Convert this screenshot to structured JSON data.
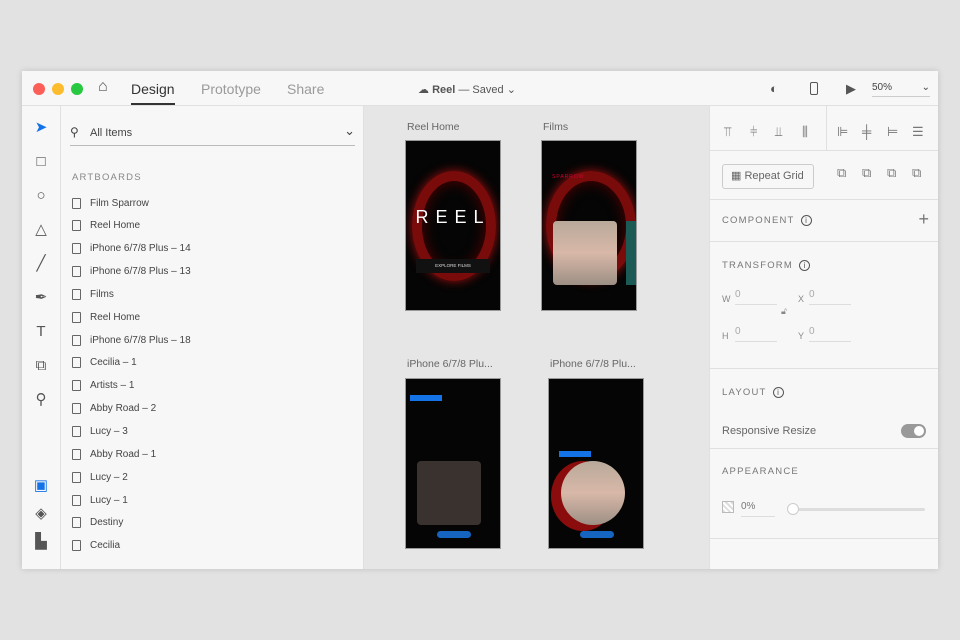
{
  "titlebar": {
    "tabs": [
      "Design",
      "Prototype",
      "Share"
    ],
    "doc_name": "Reel",
    "doc_status": "— Saved",
    "zoom": "50%"
  },
  "layers": {
    "search_label": "All Items",
    "section": "ARTBOARDS",
    "items": [
      "Film Sparrow",
      "Reel Home",
      "iPhone 6/7/8 Plus – 14",
      "iPhone 6/7/8 Plus – 13",
      "Films",
      "Reel Home",
      "iPhone 6/7/8 Plus – 18",
      "Cecilia – 1",
      "Artists – 1",
      "Abby Road – 2",
      "Lucy – 3",
      "Abby Road – 1",
      "Lucy – 2",
      "Lucy – 1",
      "Destiny",
      "Cecilia"
    ]
  },
  "canvas": {
    "artboards": [
      "Reel Home",
      "Films",
      "iPhone 6/7/8 Plu...",
      "iPhone 6/7/8 Plu..."
    ],
    "reel_title": "REEL",
    "explore": "EXPLORE FILMS",
    "films_heading": "SPARROW"
  },
  "right": {
    "repeat_grid": "Repeat Grid",
    "component": "COMPONENT",
    "transform": "TRANSFORM",
    "w_label": "W",
    "h_label": "H",
    "x_label": "X",
    "y_label": "Y",
    "w": "0",
    "h": "0",
    "x": "0",
    "y": "0",
    "layout": "LAYOUT",
    "responsive": "Responsive Resize",
    "appearance": "APPEARANCE",
    "opacity": "0%"
  }
}
